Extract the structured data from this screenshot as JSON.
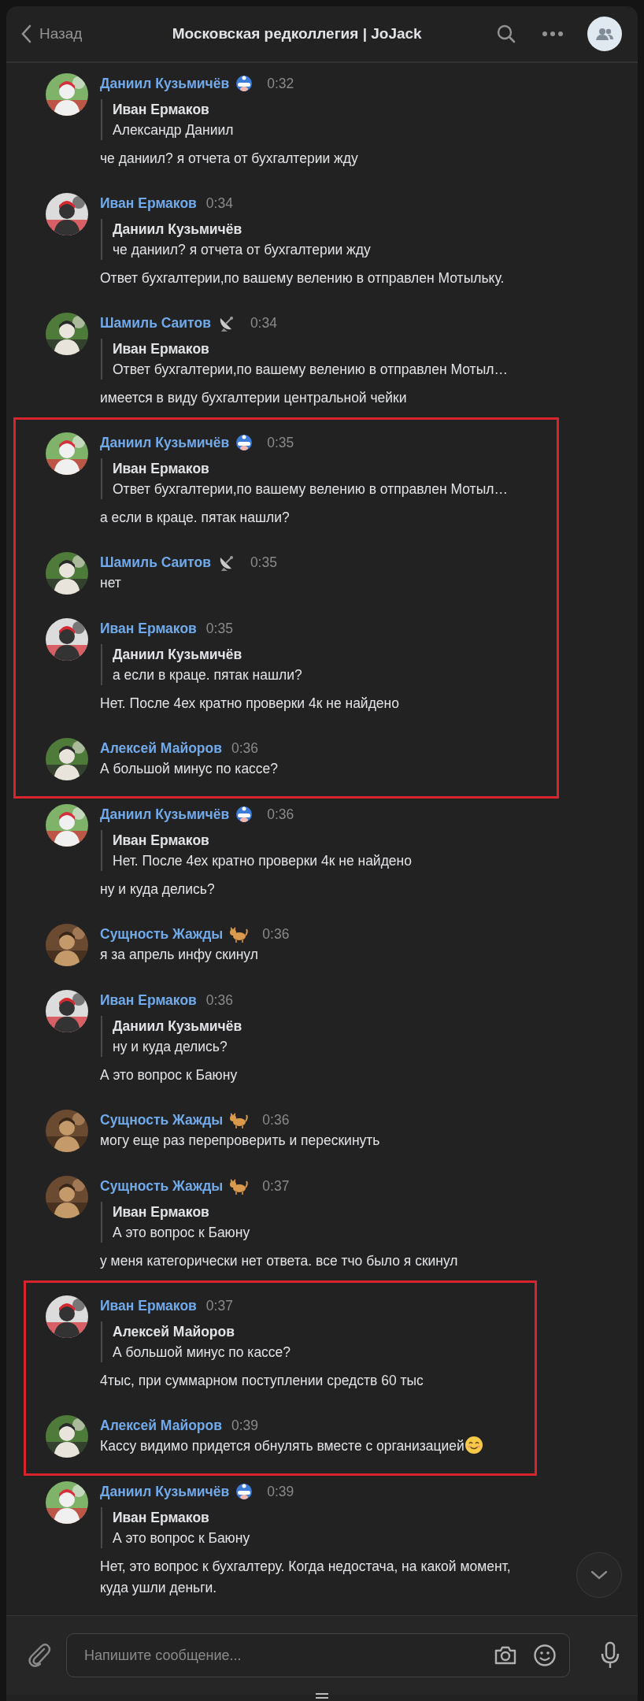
{
  "header": {
    "back_label": "Назад",
    "title": "Московская редколлегия | JoJack"
  },
  "blocks": [
    {
      "highlighted": false,
      "messages": [
        {
          "author": "Даниил Кузьмичёв",
          "badge": {
            "kind": "hero"
          },
          "time": "0:32",
          "reply": {
            "author": "Иван Ермаков",
            "text": "Александр Даниил"
          },
          "text": "че даниил? я отчета от бухгалтерии жду"
        },
        {
          "author": "Иван Ермаков",
          "time": "0:34",
          "reply": {
            "author": "Даниил Кузьмичёв",
            "text": "че даниил? я отчета от бухгалтерии жду"
          },
          "text": "Ответ бухгалтерии,по вашему велению в отправлен Мотыльку."
        },
        {
          "author": "Шамиль Саитов",
          "badge": {
            "kind": "dish"
          },
          "time": "0:34",
          "reply": {
            "author": "Иван Ермаков",
            "text": "Ответ бухгалтерии,по вашему велению в отправлен Мотыл…"
          },
          "text": "имеется в виду бухгалтерии центральной чейки"
        }
      ]
    },
    {
      "highlighted": true,
      "messages": [
        {
          "author": "Даниил Кузьмичёв",
          "badge": {
            "kind": "hero"
          },
          "time": "0:35",
          "reply": {
            "author": "Иван Ермаков",
            "text": "Ответ бухгалтерии,по вашему велению в отправлен Мотыл…"
          },
          "text": "а если в краце. пятак нашли?"
        },
        {
          "author": "Шамиль Саитов",
          "badge": {
            "kind": "dish"
          },
          "time": "0:35",
          "text": "нет"
        },
        {
          "author": "Иван Ермаков",
          "time": "0:35",
          "reply": {
            "author": "Даниил Кузьмичёв",
            "text": "а если в краце. пятак нашли?"
          },
          "text": "Нет. После 4ех кратно проверки 4к не найдено"
        },
        {
          "author": "Алексей Майоров",
          "time": "0:36",
          "text": "А большой минус по кассе?"
        }
      ]
    },
    {
      "highlighted": false,
      "messages": [
        {
          "author": "Даниил Кузьмичёв",
          "badge": {
            "kind": "hero"
          },
          "time": "0:36",
          "reply": {
            "author": "Иван Ермаков",
            "text": "Нет. После 4ех кратно проверки 4к не найдено"
          },
          "text": "ну и куда делись?"
        },
        {
          "author": "Сущность Жажды",
          "badge": {
            "kind": "cat"
          },
          "time": "0:36",
          "text": "я за апрель инфу скинул"
        },
        {
          "author": "Иван Ермаков",
          "time": "0:36",
          "reply": {
            "author": "Даниил Кузьмичёв",
            "text": "ну и куда делись?"
          },
          "text": "А это вопрос к Баюну"
        },
        {
          "author": "Сущность Жажды",
          "badge": {
            "kind": "cat"
          },
          "time": "0:36",
          "text": "могу еще раз перепроверить и перескинуть"
        },
        {
          "author": "Сущность Жажды",
          "badge": {
            "kind": "cat"
          },
          "time": "0:37",
          "reply": {
            "author": "Иван Ермаков",
            "text": "А это вопрос к Баюну"
          },
          "text": "у меня категорически нет ответа. все тчо было я скинул"
        }
      ]
    },
    {
      "highlighted": true,
      "messages": [
        {
          "author": "Иван Ермаков",
          "time": "0:37",
          "reply": {
            "author": "Алексей Майоров",
            "text": "А большой минус по кассе?"
          },
          "text": "4тыс, при суммарном поступлении средств 60 тыс"
        },
        {
          "author": "Алексей Майоров",
          "time": "0:39",
          "text": "Кассу видимо придется обнулять вместе с организацией",
          "trailing_emoji": {
            "kind": "smile"
          }
        }
      ]
    },
    {
      "highlighted": false,
      "messages": [
        {
          "author": "Даниил Кузьмичёв",
          "badge": {
            "kind": "hero"
          },
          "time": "0:39",
          "reply": {
            "author": "Иван Ермаков",
            "text": "А это вопрос к Баюну"
          },
          "text": "Нет, это вопрос к бухгалтеру. Когда недостача, на какой момент, куда ушли деньги."
        }
      ]
    }
  ],
  "composer": {
    "placeholder": "Напишите сообщение..."
  }
}
